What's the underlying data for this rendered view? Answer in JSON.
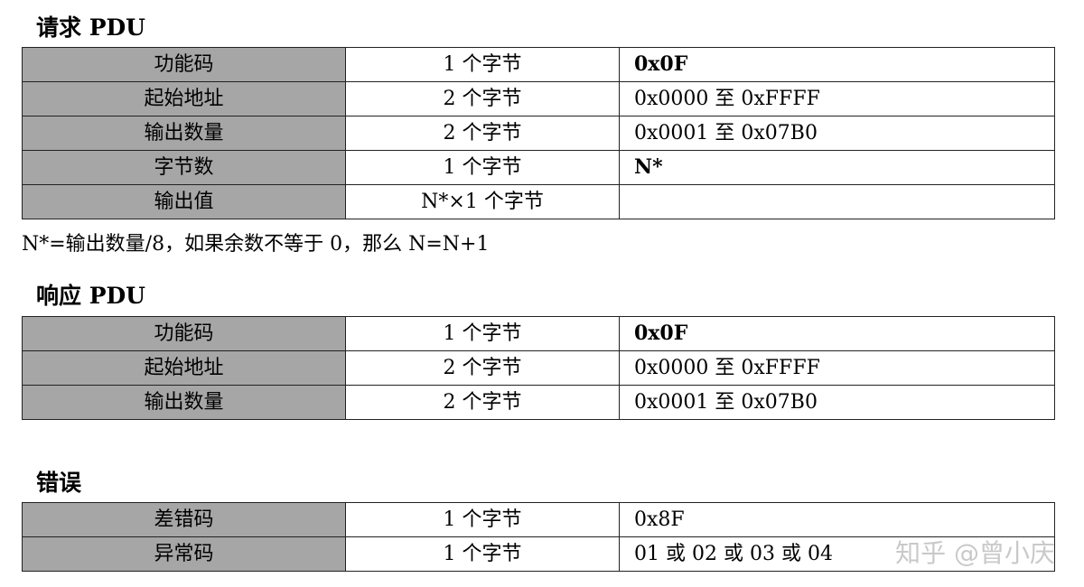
{
  "request": {
    "title": "请求 PDU",
    "rows": [
      {
        "name": "功能码",
        "size": "1 个字节",
        "range": "0x0F",
        "bold": true
      },
      {
        "name": "起始地址",
        "size": "2 个字节",
        "range": "0x0000 至 0xFFFF",
        "bold": false
      },
      {
        "name": "输出数量",
        "size": "2 个字节",
        "range": "0x0001 至 0x07B0",
        "bold": false
      },
      {
        "name": "字节数",
        "size": "1 个字节",
        "range": "N*",
        "bold": true
      },
      {
        "name": "输出值",
        "size": "N*×1 个字节",
        "range": "",
        "bold": false
      }
    ],
    "note": "N*=输出数量/8，如果余数不等于 0，那么 N=N+1"
  },
  "response": {
    "title": "响应 PDU",
    "rows": [
      {
        "name": "功能码",
        "size": "1 个字节",
        "range": "0x0F",
        "bold": true
      },
      {
        "name": "起始地址",
        "size": "2 个字节",
        "range": "0x0000 至 0xFFFF",
        "bold": false
      },
      {
        "name": "输出数量",
        "size": "2 个字节",
        "range": "0x0001 至 0x07B0",
        "bold": false
      }
    ]
  },
  "error": {
    "title": "错误",
    "rows": [
      {
        "name": "差错码",
        "size": "1 个字节",
        "range": "0x8F",
        "bold": false
      },
      {
        "name": "异常码",
        "size": "1 个字节",
        "range": "01 或 02 或 03 或 04",
        "bold": false
      }
    ]
  },
  "watermark": "知乎 @曾小庆"
}
